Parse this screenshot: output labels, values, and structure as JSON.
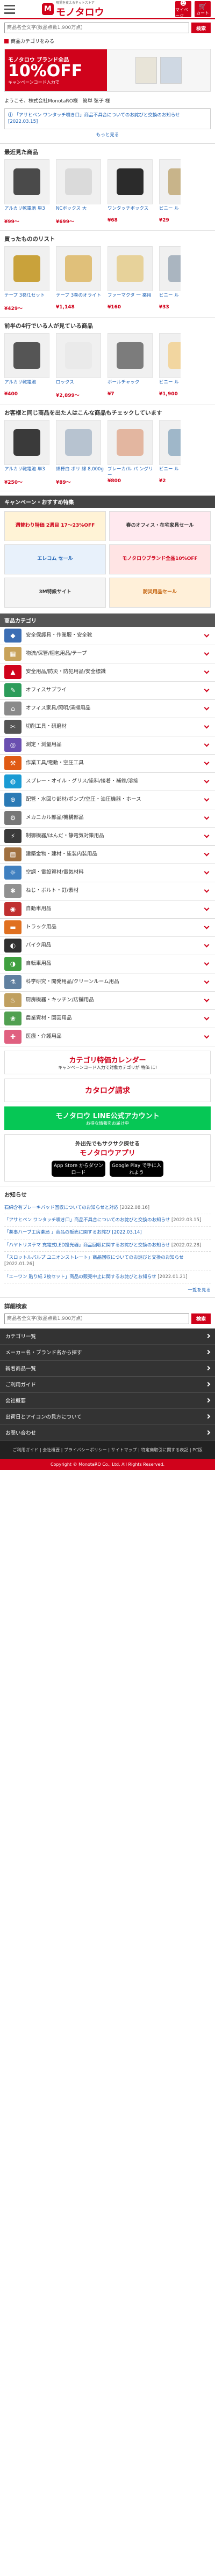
{
  "header": {
    "logo_mark": "M",
    "logo_text": "モノタロウ",
    "logo_tagline": "現場を支えるネットストア",
    "icons": [
      {
        "name": "mypage-icon",
        "label": "マイページ"
      },
      {
        "name": "cart-icon",
        "label": "カート"
      }
    ]
  },
  "search": {
    "placeholder": "商品名全文字(数品点数1,900万点)",
    "button": "検索"
  },
  "favorites_link": "商品カテゴリをみる",
  "banner": {
    "line1": "モノタロウ ブランド全品",
    "line2": "10%OFF",
    "line3": "キャンペーンコード入力で"
  },
  "greeting": "ようこそ、株式会社MonotaRO様　簡単 弦子 様",
  "notice": {
    "title": "「アサヒペン ワンタッチ噴き口」商品不具合についてのお詫びと交換のお知らせ [2022.03.15]",
    "more": "もっと見る"
  },
  "sections": [
    {
      "title": "最近見た商品",
      "products": [
        {
          "name": "アルカリ乾電池 単3",
          "price": "¥99〜",
          "color": "#4a4a4a"
        },
        {
          "name": "NCボックス 大",
          "price": "¥699〜",
          "color": "#dadada"
        },
        {
          "name": "ワンタッチボックス",
          "price": "¥68",
          "color": "#2b2b2b"
        },
        {
          "name": "ビニー ル",
          "price": "¥29",
          "color": "#c8b48a"
        }
      ]
    },
    {
      "title": "買ったもののリスト",
      "products": [
        {
          "name": "テープ 3巻/1セット",
          "price": "¥429〜",
          "color": "#c9a23b"
        },
        {
          "name": "テープ 3巻のオライト",
          "price": "¥1,148",
          "color": "#e0c07a"
        },
        {
          "name": "ファーマクタ 一 薬用",
          "price": "¥160",
          "color": "#e7d29a"
        },
        {
          "name": "ビニー ル",
          "price": "¥33",
          "color": "#aab5c0"
        }
      ]
    },
    {
      "title": "前半の4行でいる人が見ている商品",
      "products": [
        {
          "name": "アルカリ乾電池",
          "price": "¥400",
          "color": "#555555"
        },
        {
          "name": "ロックス",
          "price": "¥2,899〜",
          "color": "#eaeaea"
        },
        {
          "name": "ボールチャック",
          "price": "¥7",
          "color": "#7c7c7c"
        },
        {
          "name": "ビニー ル",
          "price": "¥1,900",
          "color": "#f2d6a0"
        }
      ]
    },
    {
      "title": "お客様と同じ商品を出た人はこんな商品もチェックしています",
      "products": [
        {
          "name": "アルカリ乾電池 単3",
          "price": "¥250〜",
          "color": "#3a3a3a"
        },
        {
          "name": "綿棒白 ポリ 綿 8,000g",
          "price": "¥89〜",
          "color": "#b7c3d0"
        },
        {
          "name": "ブレーカ/ル パ ングリー",
          "price": "¥800",
          "color": "#e3b6a0"
        },
        {
          "name": "ビニー ル",
          "price": "¥2",
          "color": "#9fb7c9"
        }
      ]
    }
  ],
  "campaign": {
    "title": "キャンペーン・おすすめ特集",
    "items": [
      {
        "text": "週替わり特価 2週目 17〜23%OFF",
        "bg": "#fff3d6",
        "color": "#d0021b"
      },
      {
        "text": "春のオフィス・在宅家具セール",
        "bg": "#ffe9ef",
        "color": "#333333"
      },
      {
        "text": "エレコム セール",
        "bg": "#e8f1fb",
        "color": "#1a5fb4"
      },
      {
        "text": "モノタロウブランド全品10%OFF",
        "bg": "#ffe4e4",
        "color": "#d0021b"
      },
      {
        "text": "3M特設サイト",
        "bg": "#f4f4f4",
        "color": "#333333"
      },
      {
        "text": "防災用品セール",
        "bg": "#fff0d9",
        "color": "#c05a00"
      }
    ]
  },
  "categories": {
    "title": "商品カテゴリ",
    "items": [
      {
        "label": "安全保護具・作業服・安全靴",
        "color": "#3c6eb4",
        "icon": "◆"
      },
      {
        "label": "物流/保管/梱包用品/テープ",
        "color": "#c8a25a",
        "icon": "▦"
      },
      {
        "label": "安全用品/防災・防犯用品/安全標識",
        "color": "#d0021b",
        "icon": "▲"
      },
      {
        "label": "オフィスサプライ",
        "color": "#2c9c5a",
        "icon": "✎"
      },
      {
        "label": "オフィス家具/照明/清掃用品",
        "color": "#8a8a8a",
        "icon": "⌂"
      },
      {
        "label": "切削工具・研磨材",
        "color": "#555555",
        "icon": "✂"
      },
      {
        "label": "測定・測量用品",
        "color": "#6a4fb0",
        "icon": "◎"
      },
      {
        "label": "作業工具/電動・空圧工具",
        "color": "#e05a14",
        "icon": "⚒"
      },
      {
        "label": "スプレー・オイル・グリス/塗料/接着・補修/溶接",
        "color": "#1a9bd4",
        "icon": "◍"
      },
      {
        "label": "配管・水回り部材/ポンプ/空圧・油圧機器・ホース",
        "color": "#2a7ab5",
        "icon": "⊕"
      },
      {
        "label": "メカニカル部品/機構部品",
        "color": "#777777",
        "icon": "⚙"
      },
      {
        "label": "制御機器/はんだ・静電気対策用品",
        "color": "#3a3a3a",
        "icon": "⚡"
      },
      {
        "label": "建築金物・建材・塗装内装用品",
        "color": "#a07040",
        "icon": "▤"
      },
      {
        "label": "空調・電設資材/電気材料",
        "color": "#4080c0",
        "icon": "☼"
      },
      {
        "label": "ねじ・ボルト・釘/素材",
        "color": "#909090",
        "icon": "✱"
      },
      {
        "label": "自動車用品",
        "color": "#c03030",
        "icon": "◉"
      },
      {
        "label": "トラック用品",
        "color": "#e07020",
        "icon": "▬"
      },
      {
        "label": "バイク用品",
        "color": "#303030",
        "icon": "◐"
      },
      {
        "label": "自転車用品",
        "color": "#40a040",
        "icon": "◑"
      },
      {
        "label": "科学研究・開発用品/クリーンルーム用品",
        "color": "#6080a0",
        "icon": "⚗"
      },
      {
        "label": "厨房機器・キッチン/店舗用品",
        "color": "#c0a060",
        "icon": "♨"
      },
      {
        "label": "農業資材・園芸用品",
        "color": "#50a050",
        "icon": "❀"
      },
      {
        "label": "医療・介護用品",
        "color": "#e06080",
        "icon": "✚"
      }
    ]
  },
  "promos": {
    "calendar_title": "カテゴリ特価カレンダー",
    "calendar_sub": "キャンペーンコード入力で対象カテゴリが 特価 に!",
    "catalog": "カタログ請求",
    "line_title": "モノタロウ LINE公式アカウント",
    "line_sub": "お得な情報をお届け中"
  },
  "app": {
    "title_pre": "外出先でもサクサク探せる",
    "title_brand": "モノタロウアプリ",
    "app_store": "App Store からダウンロード",
    "google_play": "Google Play で手に入れよう"
  },
  "news": {
    "title": "お知らせ",
    "items": [
      {
        "text": "石綿含有ブレーキパッド回収についてのお知らせと対応",
        "date": "[2022.08.16]"
      },
      {
        "text": "「アサヒペン ワンタッチ噴き口」商品不具合についてのお詫びと交換のお知らせ",
        "date": "[2022.03.15]"
      },
      {
        "text": "「薬事ハーブ工房薬局 」商品の販売に関するお詫び [2022.03.14]",
        "date": ""
      },
      {
        "text": "「ハヤトリステマ 充電式LED投光器」商品回収に関するお詫びと交換のお知らせ",
        "date": "[2022.02.28]"
      },
      {
        "text": "「スロットルパルプ ユニオンストレート」商品回収についてのお詫びと交換のお知らせ",
        "date": "[2022.01.26]"
      },
      {
        "text": "「エーワン 貼り紙 2枚セット」商品の販売中止に関するお詫びとお知らせ",
        "date": "[2022.01.21]"
      }
    ],
    "more": "一覧を見る"
  },
  "detail_search": {
    "title": "詳細検索",
    "placeholder": "商品名全文字(数品点数1,900万点)",
    "button": "検索"
  },
  "footer_menu": [
    "カテゴリ一覧",
    "メーカー名・ブランド名から探す",
    "新着商品一覧",
    "ご利用ガイド",
    "会社概要",
    "出荷日とアイコンの見方について",
    "お問い合わせ"
  ],
  "footer_links": "ご利用ガイド | 会社概要 | プライバシーポリシー | サイトマップ | 特定商取引に関する表記 | PC版",
  "copyright": "Copyright © MonotaRO Co., Ltd. All Rights Reserved."
}
